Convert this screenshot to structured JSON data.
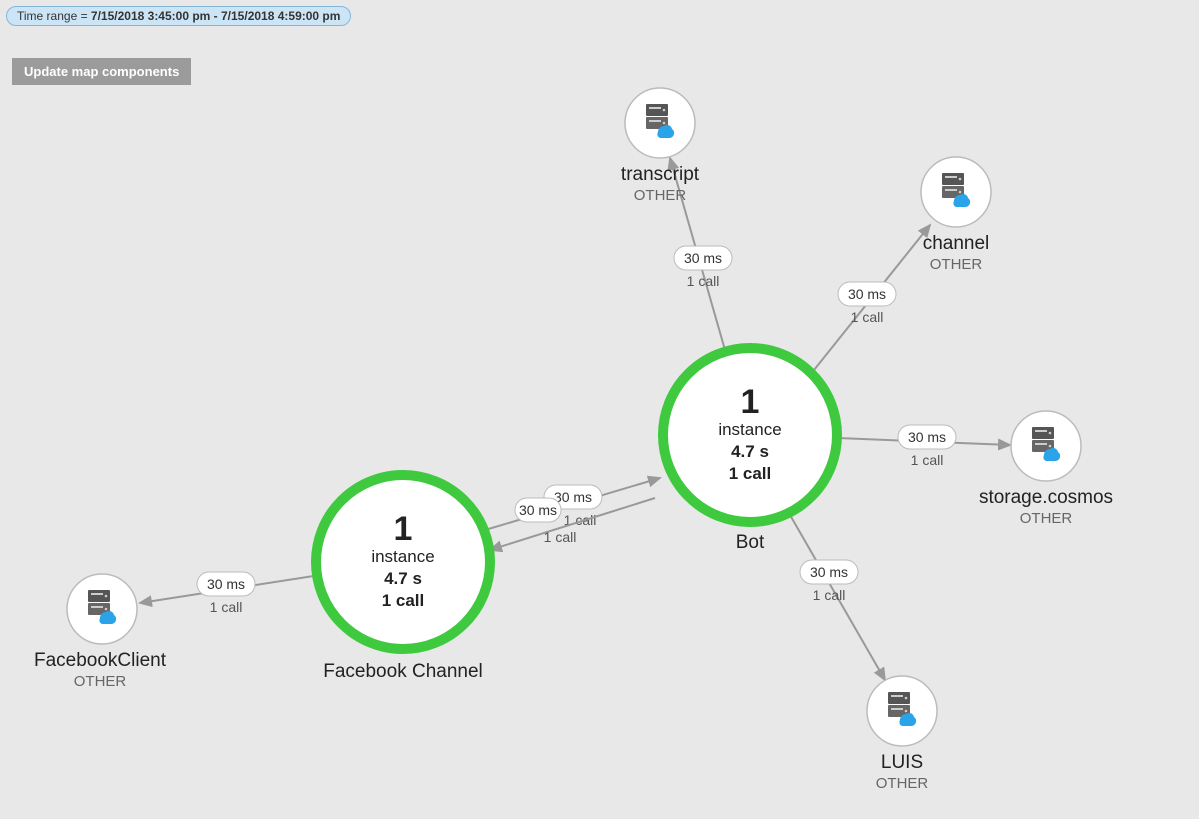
{
  "timerange": {
    "label": "Time range = ",
    "value": "7/15/2018 3:45:00 pm - 7/15/2018 4:59:00 pm"
  },
  "buttons": {
    "update_map": "Update map components"
  },
  "nodes": {
    "bot": {
      "count": "1",
      "instance": "instance",
      "latency": "4.7 s",
      "calls": "1 call",
      "title": "Bot"
    },
    "fb_channel": {
      "count": "1",
      "instance": "instance",
      "latency": "4.7 s",
      "calls": "1 call",
      "title": "Facebook Channel"
    },
    "facebook_client": {
      "title": "FacebookClient",
      "sub": "OTHER"
    },
    "transcript": {
      "title": "transcript",
      "sub": "OTHER"
    },
    "channel": {
      "title": "channel",
      "sub": "OTHER"
    },
    "storage_cosmos": {
      "title": "storage.cosmos",
      "sub": "OTHER"
    },
    "luis": {
      "title": "LUIS",
      "sub": "OTHER"
    }
  },
  "edges": {
    "bot_to_transcript": {
      "latency": "30 ms",
      "calls": "1 call"
    },
    "bot_to_channel": {
      "latency": "30 ms",
      "calls": "1 call"
    },
    "bot_to_cosmos": {
      "latency": "30 ms",
      "calls": "1 call"
    },
    "bot_to_luis": {
      "latency": "30 ms",
      "calls": "1 call"
    },
    "bot_to_fbchannel": {
      "latency": "30 ms",
      "calls": "1 call"
    },
    "fbchannel_to_bot": {
      "latency": "30 ms",
      "calls": "1 call"
    },
    "fbchannel_to_fbclient": {
      "latency": "30 ms",
      "calls": "1 call"
    }
  }
}
